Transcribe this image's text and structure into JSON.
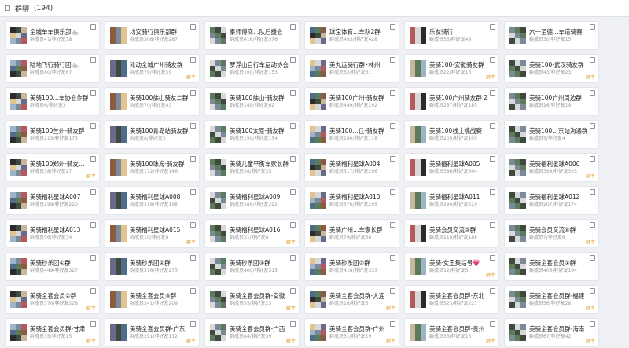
{
  "header": {
    "title": "群聊",
    "count": "(194)"
  },
  "labels": {
    "members_prefix": "群成员",
    "friends_prefix": "/非好友"
  },
  "colors": {
    "owner": "#e4a224"
  },
  "groups": [
    {
      "name": "全城单车俱乐部🚲",
      "members": "41",
      "non_friends": "38",
      "owner": false
    },
    {
      "name": "均安骑行俱乐部群",
      "members": "306",
      "non_friends": "287",
      "owner": false
    },
    {
      "name": "秦师傅商…队后援会",
      "members": "416",
      "non_friends": "376",
      "owner": false
    },
    {
      "name": "球宝体育…车队2群",
      "members": "493",
      "non_friends": "428",
      "owner": false
    },
    {
      "name": "乐友骑行",
      "members": "56",
      "non_friends": "49",
      "owner": false
    },
    {
      "name": "六一圣德…车道骑赛",
      "members": "30",
      "non_friends": "15",
      "owner": false
    },
    {
      "name": "陆地飞行骑行团🚲",
      "members": "80",
      "non_friends": "67",
      "owner": false
    },
    {
      "name": "轮动全城广州骑友群",
      "members": "79",
      "non_friends": "39",
      "owner": true
    },
    {
      "name": "罗浮山自行车运动协会",
      "members": "160",
      "non_friends": "153",
      "owner": false
    },
    {
      "name": "美丸运骑行群•林州",
      "members": "63",
      "non_friends": "61",
      "owner": false
    },
    {
      "name": "美骑100-安徽骑友群",
      "members": "22",
      "non_friends": "15",
      "owner": true
    },
    {
      "name": "美骑100-武汉骑友群",
      "members": "43",
      "non_friends": "23",
      "owner": true
    },
    {
      "name": "美骑100…车协会作群",
      "members": "6",
      "non_friends": "3",
      "owner": false
    },
    {
      "name": "美骑100佛山骑友二群",
      "members": "70",
      "non_friends": "43",
      "owner": false
    },
    {
      "name": "美骑100佛山-骑友群",
      "members": "148",
      "non_friends": "62",
      "owner": false
    },
    {
      "name": "美骑100广州-骑友群",
      "members": "449",
      "non_friends": "292",
      "owner": false
    },
    {
      "name": "美骑100广州骑友群 2",
      "members": "237",
      "non_friends": "185",
      "owner": false
    },
    {
      "name": "美骑100广州周边群",
      "members": "26",
      "non_friends": "19",
      "owner": false
    },
    {
      "name": "美骑100兰州-骑友群",
      "members": "213",
      "non_friends": "173",
      "owner": false
    },
    {
      "name": "美骑100青岛站骑友群",
      "members": "8",
      "non_friends": "3",
      "owner": false
    },
    {
      "name": "美骑100太原-骑友群",
      "members": "199",
      "non_friends": "154",
      "owner": false
    },
    {
      "name": "美骑100…丘-骑友群",
      "members": "140",
      "non_friends": "118",
      "owner": false
    },
    {
      "name": "美骑100线上挑战赛",
      "members": "205",
      "non_friends": "105",
      "owner": false
    },
    {
      "name": "美骑100…京站沟通群",
      "members": "5",
      "non_friends": "4",
      "owner": false
    },
    {
      "name": "美骑100郑州-骑友二群",
      "members": "38",
      "non_friends": "27",
      "owner": true
    },
    {
      "name": "美骑100珠海-骑友群",
      "members": "172",
      "non_friends": "146",
      "owner": false
    },
    {
      "name": "美骑儿童平衡车家长群",
      "members": "38",
      "non_friends": "35",
      "owner": false
    },
    {
      "name": "美骑福利星球A004",
      "members": "317",
      "non_friends": "296",
      "owner": false
    },
    {
      "name": "美骑福利星球A005",
      "members": "386",
      "non_friends": "304",
      "owner": false
    },
    {
      "name": "美骑福利星球A006",
      "members": "399",
      "non_friends": "305",
      "owner": true
    },
    {
      "name": "美骑福利星球A007",
      "members": "299",
      "non_friends": "220",
      "owner": false
    },
    {
      "name": "美骑福利星球A008",
      "members": "318",
      "non_friends": "198",
      "owner": false
    },
    {
      "name": "美骑福利星球A009",
      "members": "388",
      "non_friends": "292",
      "owner": false
    },
    {
      "name": "美骑福利星球A010",
      "members": "370",
      "non_friends": "295",
      "owner": false
    },
    {
      "name": "美骑福利星球A011",
      "members": "294",
      "non_friends": "229",
      "owner": false
    },
    {
      "name": "美骑福利星球A012",
      "members": "207",
      "non_friends": "174",
      "owner": false
    },
    {
      "name": "美骑福利星球A013",
      "members": "56",
      "non_friends": "34",
      "owner": false
    },
    {
      "name": "美骑福利星球A015",
      "members": "10",
      "non_friends": "8",
      "owner": true
    },
    {
      "name": "美骑福利星球A016",
      "members": "31",
      "non_friends": "8",
      "owner": true
    },
    {
      "name": "美骑广州…车家长群",
      "members": "76",
      "non_friends": "58",
      "owner": false
    },
    {
      "name": "美骑会员交流⑤群",
      "members": "210",
      "non_friends": "188",
      "owner": false
    },
    {
      "name": "美骑会员交流⑥群",
      "members": "7",
      "non_friends": "6",
      "owner": true
    },
    {
      "name": "美骑秒杀团①群",
      "members": "449",
      "non_friends": "327",
      "owner": false
    },
    {
      "name": "美骑秒杀团②群",
      "members": "376",
      "non_friends": "273",
      "owner": false
    },
    {
      "name": "美骑秒杀团③群",
      "members": "400",
      "non_friends": "315",
      "owner": false
    },
    {
      "name": "美骑秒杀团⑤群",
      "members": "418",
      "non_friends": "333",
      "owner": false
    },
    {
      "name": "美骑-女王集结号💗",
      "members": "12",
      "non_friends": "5",
      "owner": true
    },
    {
      "name": "美骑全套会员①群",
      "members": "406",
      "non_friends": "194",
      "owner": false
    },
    {
      "name": "美骑全套会员②群",
      "members": "370",
      "non_friends": "228",
      "owner": true
    },
    {
      "name": "美骑全套会员③群",
      "members": "341",
      "non_friends": "209",
      "owner": false
    },
    {
      "name": "美骑全套会员群-安徽",
      "members": "55",
      "non_friends": "23",
      "owner": true
    },
    {
      "name": "美骑全套会员群-大连",
      "members": "16",
      "non_friends": "5",
      "owner": true
    },
    {
      "name": "美骑全套会员群-东北",
      "members": "323",
      "non_friends": "227",
      "owner": false
    },
    {
      "name": "美骑全套会员群-福建",
      "members": "56",
      "non_friends": "28",
      "owner": true
    },
    {
      "name": "美骑全套会员群-甘肃",
      "members": "35",
      "non_friends": "15",
      "owner": true
    },
    {
      "name": "美骑全套会员群-广东",
      "members": "291",
      "non_friends": "112",
      "owner": true
    },
    {
      "name": "美骑全套会员群-广西",
      "members": "84",
      "non_friends": "39",
      "owner": true
    },
    {
      "name": "美骑全套会员群-广州",
      "members": "31",
      "non_friends": "19",
      "owner": true
    },
    {
      "name": "美骑全套会员群-贵州",
      "members": "33",
      "non_friends": "15",
      "owner": true
    },
    {
      "name": "美骑全套会员群-海南",
      "members": "67",
      "non_friends": "42",
      "owner": true
    }
  ],
  "owner_badge": "群主"
}
